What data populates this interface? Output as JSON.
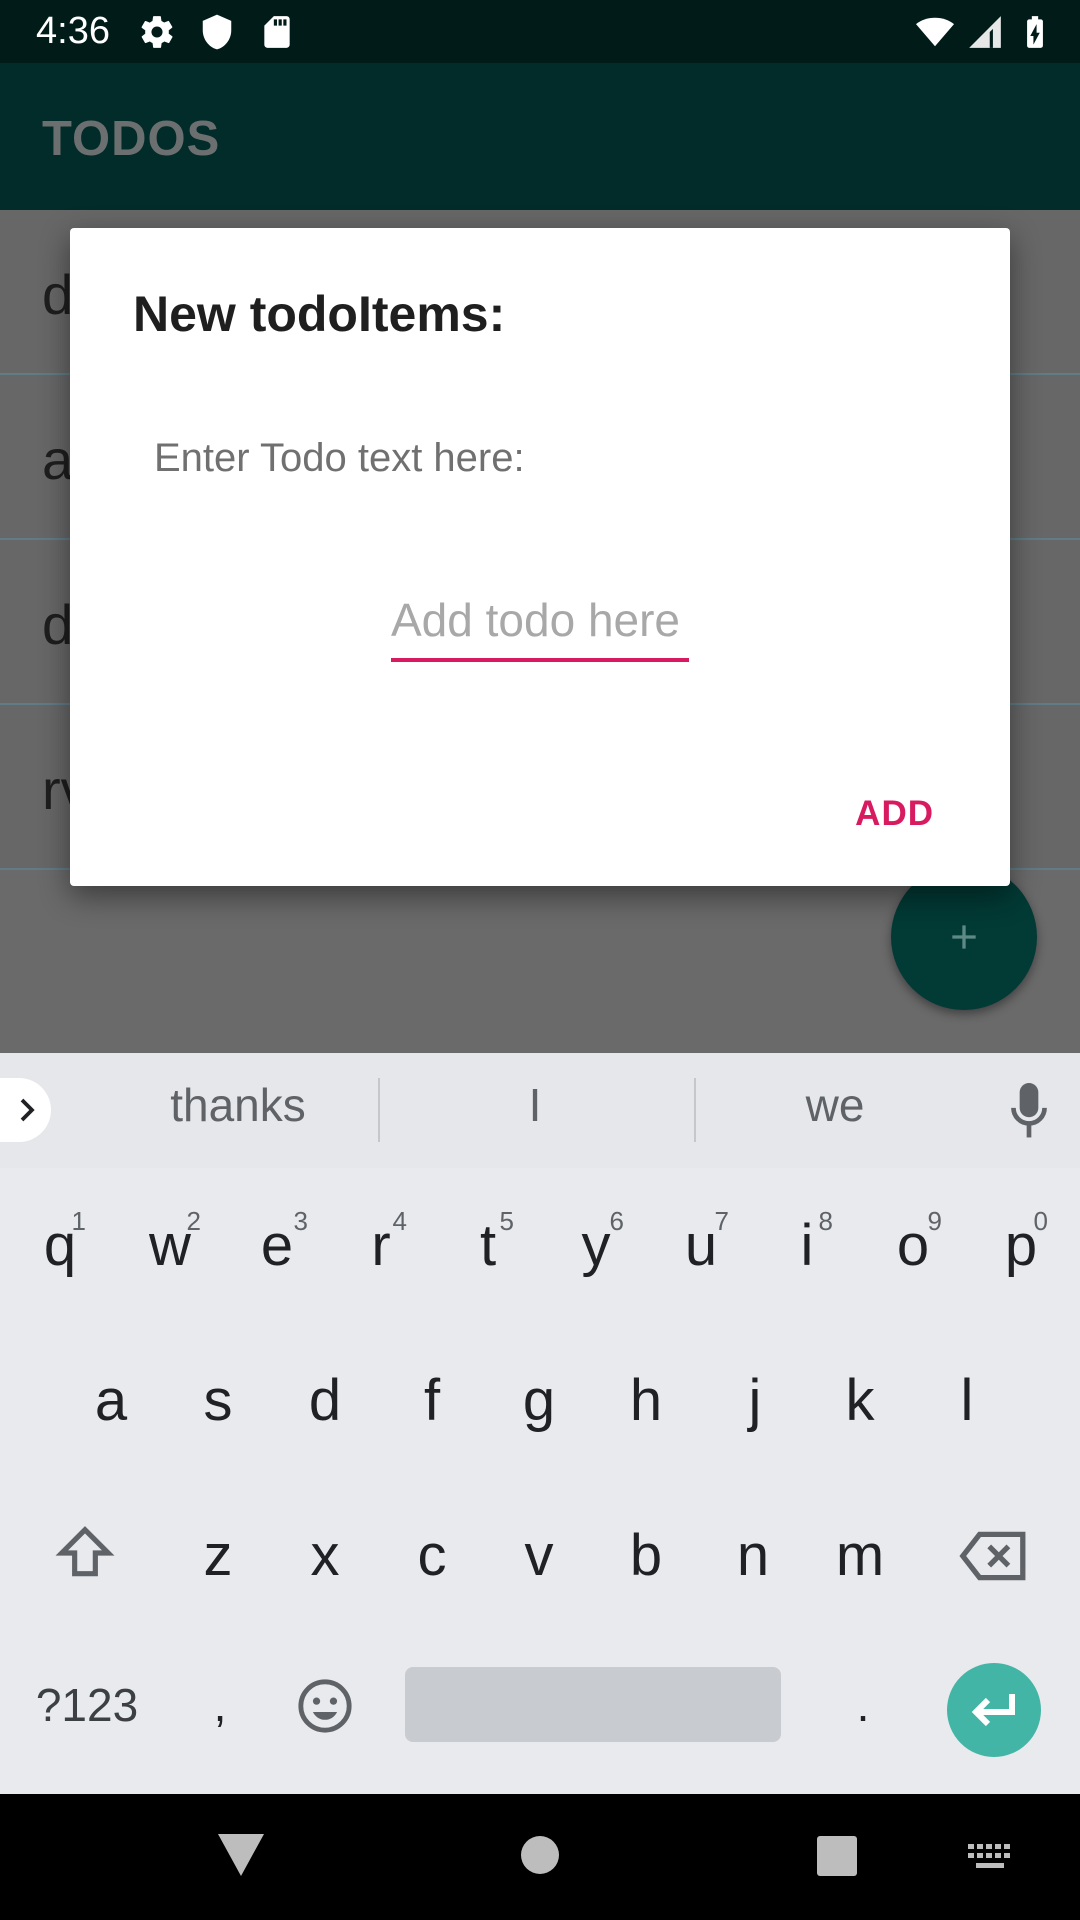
{
  "status_bar": {
    "time": "4:36",
    "left_icons": [
      "settings-icon",
      "shield-icon",
      "sd-card-icon"
    ],
    "right_icons": [
      "wifi-icon",
      "signal-icon",
      "battery-charging-icon"
    ]
  },
  "app_bar": {
    "title": "TODOS"
  },
  "list": {
    "items": [
      {
        "text": "d"
      },
      {
        "text": "a"
      },
      {
        "text": "d"
      },
      {
        "text": "rv"
      }
    ]
  },
  "fab": {
    "icon": "plus-icon"
  },
  "dialog": {
    "title": "New todoItems:",
    "label": "Enter Todo text here:",
    "input_value": "",
    "input_placeholder": "Add todo here",
    "add_button": "ADD"
  },
  "keyboard": {
    "suggestions": [
      "thanks",
      "I",
      "we"
    ],
    "row1": [
      {
        "key": "q",
        "hint": "1"
      },
      {
        "key": "w",
        "hint": "2"
      },
      {
        "key": "e",
        "hint": "3"
      },
      {
        "key": "r",
        "hint": "4"
      },
      {
        "key": "t",
        "hint": "5"
      },
      {
        "key": "y",
        "hint": "6"
      },
      {
        "key": "u",
        "hint": "7"
      },
      {
        "key": "i",
        "hint": "8"
      },
      {
        "key": "o",
        "hint": "9"
      },
      {
        "key": "p",
        "hint": "0"
      }
    ],
    "row2": [
      "a",
      "s",
      "d",
      "f",
      "g",
      "h",
      "j",
      "k",
      "l"
    ],
    "row3": [
      "z",
      "x",
      "c",
      "v",
      "b",
      "n",
      "m"
    ],
    "symbols_key": "?123",
    "comma_key": ",",
    "period_key": "."
  },
  "colors": {
    "status_bar": "#001b18",
    "app_bar": "#022c29",
    "accent": "#d81b60",
    "fab": "#023a35",
    "enter_key": "#43b5a6"
  }
}
